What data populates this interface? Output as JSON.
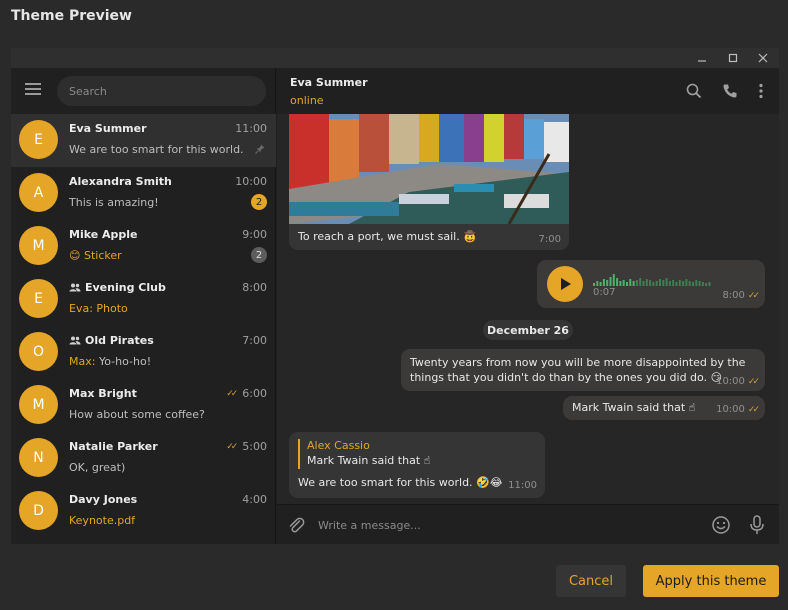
{
  "dialog": {
    "title": "Theme Preview",
    "cancel_label": "Cancel",
    "apply_label": "Apply this theme"
  },
  "window_controls": {
    "minimize": "—",
    "maximize": "☐",
    "close": "✕"
  },
  "search": {
    "placeholder": "Search"
  },
  "chats": [
    {
      "initial": "E",
      "name": "Eva Summer",
      "time": "11:00",
      "preview": "We are too smart for this world. ...",
      "pinned": true,
      "active": true
    },
    {
      "initial": "A",
      "name": "Alexandra Smith",
      "time": "10:00",
      "preview": "This is amazing!",
      "badge": "2",
      "badge_style": "gold"
    },
    {
      "initial": "M",
      "name": "Mike Apple",
      "time": "9:00",
      "preview_emoji": "😊",
      "preview": "Sticker",
      "preview_accent": true,
      "badge": "2",
      "badge_style": "grey"
    },
    {
      "initial": "E",
      "name": "Evening Club",
      "group": true,
      "time": "8:00",
      "preview": "Eva: Photo",
      "preview_accent": true
    },
    {
      "initial": "O",
      "name": "Old Pirates",
      "group": true,
      "time": "7:00",
      "sender": "Max:",
      "preview": " Yo-ho-ho!"
    },
    {
      "initial": "M",
      "name": "Max Bright",
      "time": "6:00",
      "read": true,
      "preview": "How about some coffee?"
    },
    {
      "initial": "N",
      "name": "Natalie Parker",
      "time": "5:00",
      "read": true,
      "preview": "OK, great)"
    },
    {
      "initial": "D",
      "name": "Davy Jones",
      "time": "4:00",
      "preview": "Keynote.pdf",
      "preview_accent": true
    }
  ],
  "chat": {
    "title": "Eva Summer",
    "status": "online",
    "messages": {
      "photo_caption": "To reach a port, we must sail. 🤠",
      "photo_time": "7:00",
      "voice_duration": "0:07",
      "voice_time": "8:00",
      "date_separator": "December 26",
      "long_text": "Twenty years from now you will be more disappointed by the things that you didn't do than by the ones you did do. 😏",
      "long_time": "10:00",
      "twain_text": "Mark Twain said that ☝",
      "twain_time": "10:00",
      "reply_author": "Alex Cassio",
      "reply_quote": "Mark Twain said that ☝",
      "reply_text": "We are too smart for this world. 🤣😂",
      "reply_time": "11:00"
    },
    "composer_placeholder": "Write a message..."
  },
  "colors": {
    "accent": "#e5a526",
    "background": "#1f1f1f",
    "bubble": "#353535"
  }
}
